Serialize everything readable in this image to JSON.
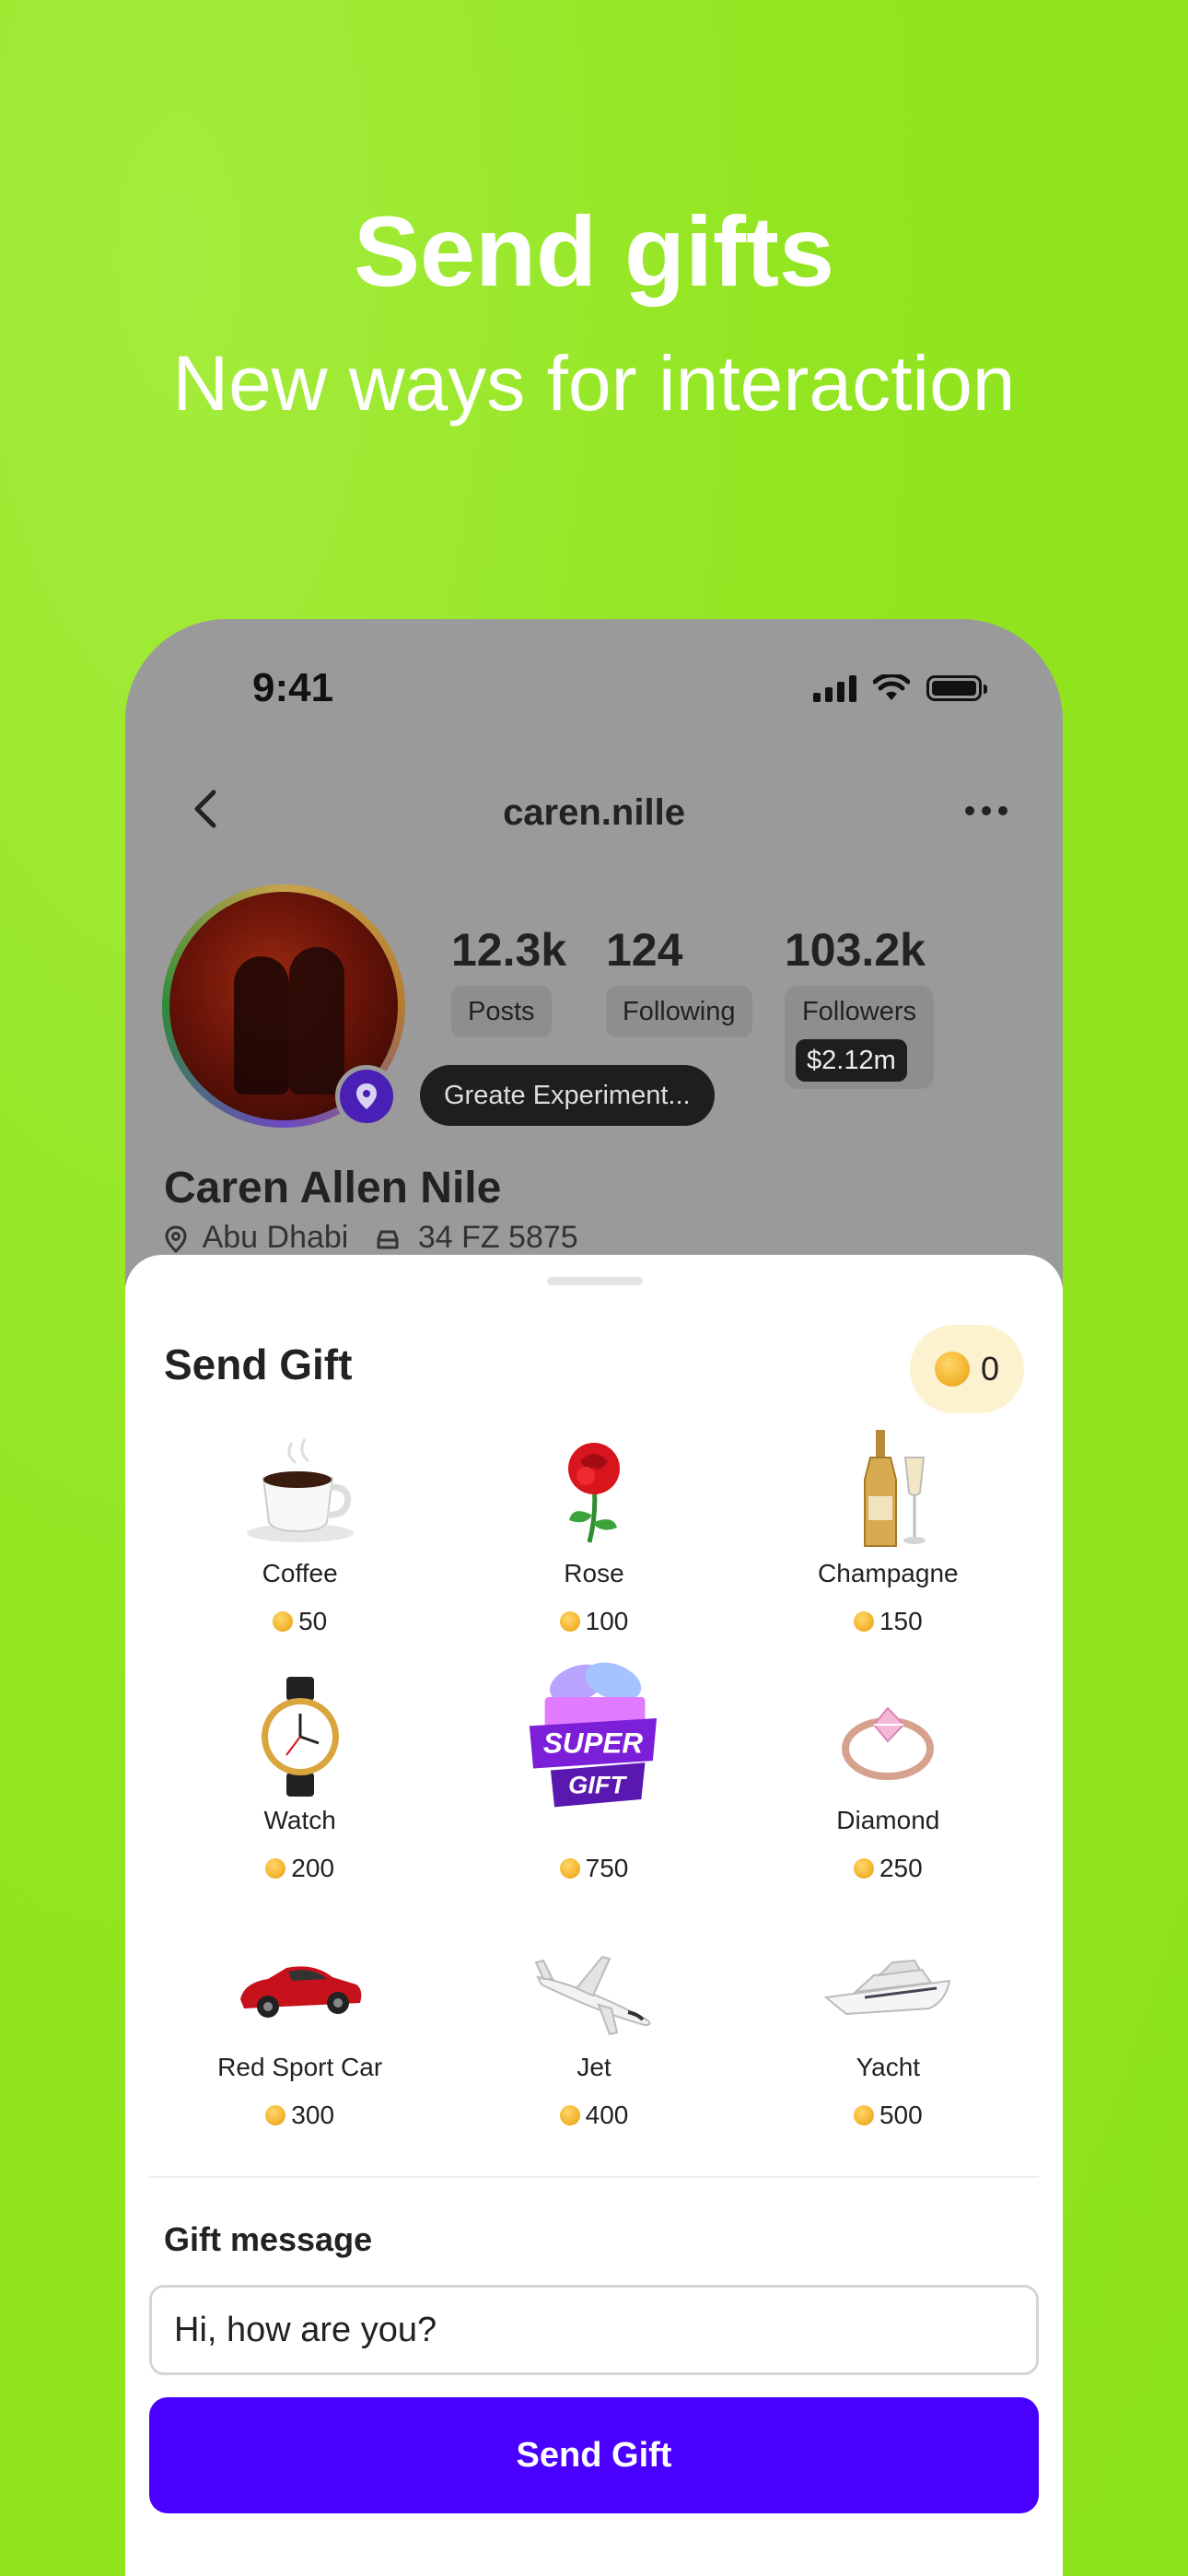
{
  "promo": {
    "title": "Send gifts",
    "subtitle": "New ways for interaction"
  },
  "status_bar": {
    "time": "9:41"
  },
  "nav": {
    "username": "caren.nille"
  },
  "profile": {
    "stats": [
      {
        "value": "12.3k",
        "label": "Posts"
      },
      {
        "value": "124",
        "label": "Following"
      },
      {
        "value": "103.2k",
        "label": "Followers",
        "earnings": "$2.12m"
      }
    ],
    "tooltip": "Greate Experiment...",
    "full_name": "Caren Allen Nile",
    "location": "Abu Dhabi",
    "plate": "34 FZ 5875"
  },
  "sheet": {
    "title": "Send Gift",
    "balance": "0",
    "gifts": [
      {
        "name": "Coffee",
        "price": "50",
        "icon": "coffee-icon"
      },
      {
        "name": "Rose",
        "price": "100",
        "icon": "rose-icon"
      },
      {
        "name": "Champagne",
        "price": "150",
        "icon": "champagne-icon"
      },
      {
        "name": "Watch",
        "price": "200",
        "icon": "watch-icon"
      },
      {
        "name": "",
        "price": "750",
        "icon": "super-gift-icon",
        "badge_top": "SUPER",
        "badge_bottom": "GIFT"
      },
      {
        "name": "Diamond",
        "price": "250",
        "icon": "diamond-ring-icon"
      },
      {
        "name": "Red Sport Car",
        "price": "300",
        "icon": "sport-car-icon"
      },
      {
        "name": "Jet",
        "price": "400",
        "icon": "jet-icon"
      },
      {
        "name": "Yacht",
        "price": "500",
        "icon": "yacht-icon"
      }
    ],
    "message_label": "Gift message",
    "message_value": "Hi, how are you?",
    "send_label": "Send Gift"
  },
  "colors": {
    "background": "#92e520",
    "primary": "#4a00ff",
    "coin": "#f2b22b",
    "balance_bg": "#fdf2cf"
  }
}
